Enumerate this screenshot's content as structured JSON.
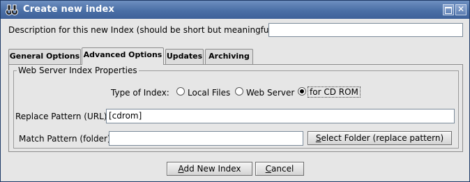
{
  "window": {
    "title": "Create new index",
    "icon": "binoculars-icon",
    "controls": {
      "maximize_icon": "maximize-icon",
      "close_icon": "close-icon",
      "close_glyph": "✕"
    }
  },
  "description": {
    "label": "Description for this new Index (should be short but meaningful):",
    "value": ""
  },
  "tabs": [
    {
      "label": "General Options",
      "active": false
    },
    {
      "label": "Advanced Options",
      "active": true
    },
    {
      "label": "Updates",
      "active": false
    },
    {
      "label": "Archiving",
      "active": false
    }
  ],
  "group": {
    "title": "Web Server Index Properties",
    "type_label": "Type of Index:",
    "options": [
      {
        "label": "Local Files",
        "checked": false
      },
      {
        "label": "Web Server",
        "checked": false
      },
      {
        "label": "for CD ROM",
        "checked": true
      }
    ],
    "replace_label": "Replace Pattern (URL)",
    "replace_value": "[cdrom]",
    "match_label": "Match Pattern (folder)",
    "match_value": "",
    "select_button": {
      "mnemonic": "S",
      "rest": "elect Folder (replace pattern)"
    }
  },
  "footer": {
    "add_button": {
      "mnemonic": "A",
      "rest": "dd New Index"
    },
    "cancel_button": {
      "mnemonic": "C",
      "rest": "ancel"
    }
  },
  "colors": {
    "titlebar": "#4a6fa6",
    "background": "#e6e6e6"
  }
}
